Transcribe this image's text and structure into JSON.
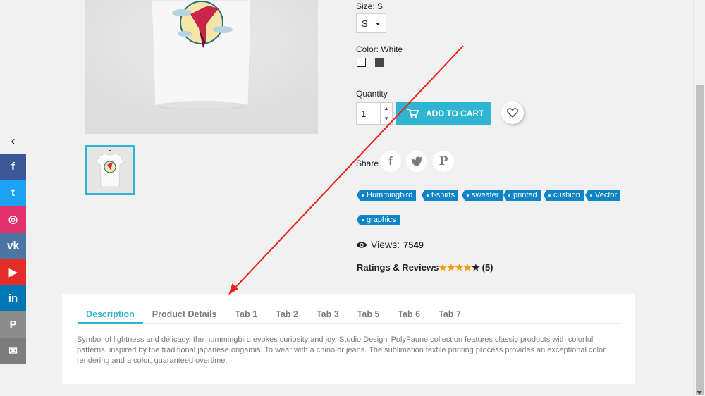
{
  "product": {
    "size_label": "Size: S",
    "size_value": "S",
    "color_label": "Color: White",
    "colors": [
      "#ffffff",
      "#414850"
    ],
    "quantity_label": "Quantity",
    "quantity_value": "1",
    "add_to_cart": "ADD TO CART",
    "share_label": "Share",
    "views_label": "Views:",
    "views_count": "7549",
    "ratings_label": "Ratings & Reviews",
    "rating_stars": 4,
    "rating_max": 5,
    "reviews_count": "(5)"
  },
  "tags": [
    "Hummingbird",
    "t-shirts",
    "sweater",
    "printed",
    "cushion",
    "Vector",
    "graphics"
  ],
  "social": [
    {
      "name": "facebook",
      "glyph": "f",
      "color": "#3b5998"
    },
    {
      "name": "twitter",
      "glyph": "t",
      "color": "#1da1f2"
    },
    {
      "name": "instagram",
      "glyph": "◎",
      "color": "#e1306c"
    },
    {
      "name": "vk",
      "glyph": "vk",
      "color": "#4c75a3"
    },
    {
      "name": "youtube",
      "glyph": "▶",
      "color": "#e52d27"
    },
    {
      "name": "linkedin",
      "glyph": "in",
      "color": "#0077b5"
    },
    {
      "name": "pinterest",
      "glyph": "P",
      "color": "#8c8c8c"
    },
    {
      "name": "email",
      "glyph": "✉",
      "color": "#7d7d7d"
    }
  ],
  "tabs": [
    "Description",
    "Product Details",
    "Tab 1",
    "Tab 2",
    "Tab 3",
    "Tab 5",
    "Tab 6",
    "Tab 7"
  ],
  "description": "Symbol of lightness and delicacy, the hummingbird evokes curiosity and joy. Studio Design' PolyFaune collection features classic products with colorful patterns, inspired by the traditional japanese origamis. To wear with a chino or jeans. The sublimation textile printing process provides an exceptional color rendering and a color, guaranteed overtime.",
  "colors": {
    "accent": "#2fb5d2",
    "tag": "#0e84c6",
    "star": "#f39c12",
    "annotation": "#e8221a"
  }
}
